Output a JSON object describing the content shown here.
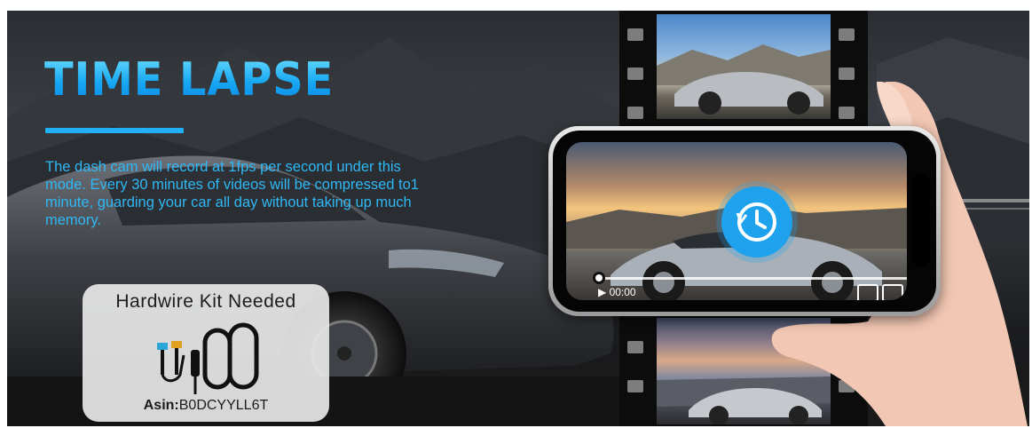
{
  "hero": {
    "title": "TIME LAPSE",
    "description": "The dash cam will record at 1fps per second under this mode. Every 30 minutes of videos will be compressed to1 minute, guarding your car all day without taking up much memory."
  },
  "hardwire_card": {
    "title": "Hardwire Kit Needed",
    "asin_label": "Asin:",
    "asin_value": "B0DCYYLL6T"
  },
  "player": {
    "time": "00:00",
    "play_glyph": "▶",
    "overlay_icon": "clock-history-icon"
  },
  "colors": {
    "accent": "#1fb0f5",
    "title_gradient_top": "#6fe0ff",
    "title_gradient_bottom": "#0c84e0",
    "card_bg": "#e8e8e8"
  }
}
